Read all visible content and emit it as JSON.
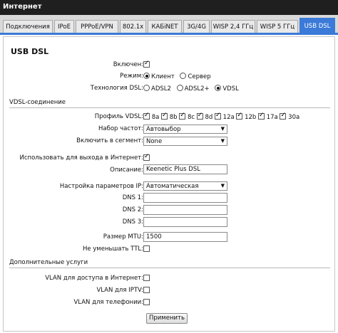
{
  "window_title": "Интернет",
  "tabs": [
    {
      "label": "Подключения",
      "active": false
    },
    {
      "label": "IPoE",
      "active": false
    },
    {
      "label": "PPPoE/VPN",
      "active": false
    },
    {
      "label": "802.1x",
      "active": false
    },
    {
      "label": "КАБiNET",
      "active": false
    },
    {
      "label": "3G/4G",
      "active": false
    },
    {
      "label": "WISP 2,4 ГГц",
      "active": false
    },
    {
      "label": "WISP 5 ГГц",
      "active": false
    },
    {
      "label": "USB DSL",
      "active": true
    }
  ],
  "page_heading": "USB DSL",
  "general": {
    "enabled_label": "Включен:",
    "enabled": true,
    "mode_label": "Режим:",
    "mode_options": [
      "Клиент",
      "Сервер"
    ],
    "mode_selected": "Клиент",
    "tech_label": "Технология DSL:",
    "tech_options": [
      "ADSL2",
      "ADSL2+",
      "VDSL"
    ],
    "tech_selected": "VDSL"
  },
  "vdsl": {
    "section_title": "VDSL-соединение",
    "profile_label": "Профиль VDSL:",
    "profiles": [
      "8a",
      "8b",
      "8c",
      "8d",
      "12a",
      "12b",
      "17a",
      "30a"
    ],
    "freq_label": "Набор частот:",
    "freq_value": "Автовыбор",
    "segment_label": "Включить в сегмент:",
    "segment_value": "None",
    "use_internet_label": "Использовать для выхода в Интернет:",
    "use_internet": true,
    "desc_label": "Описание:",
    "desc_value": "Keenetic Plus DSL",
    "ip_label": "Настройка параметров IP:",
    "ip_value": "Автоматическая",
    "dns1_label": "DNS 1:",
    "dns1_value": "",
    "dns2_label": "DNS 2:",
    "dns2_value": "",
    "dns3_label": "DNS 3:",
    "dns3_value": "",
    "mtu_label": "Размер MTU:",
    "mtu_value": "1500",
    "ttl_label": "Не уменьшать TTL:",
    "ttl": false
  },
  "extra": {
    "section_title": "Дополнительные услуги",
    "vlan_internet_label": "VLAN для доступа в Интернет:",
    "vlan_iptv_label": "VLAN для IPTV:",
    "vlan_phone_label": "VLAN для телефонии:"
  },
  "apply_label": "Применить",
  "colors": {
    "accent": "#3b7ad8",
    "titlebar": "#1f1f1f"
  }
}
